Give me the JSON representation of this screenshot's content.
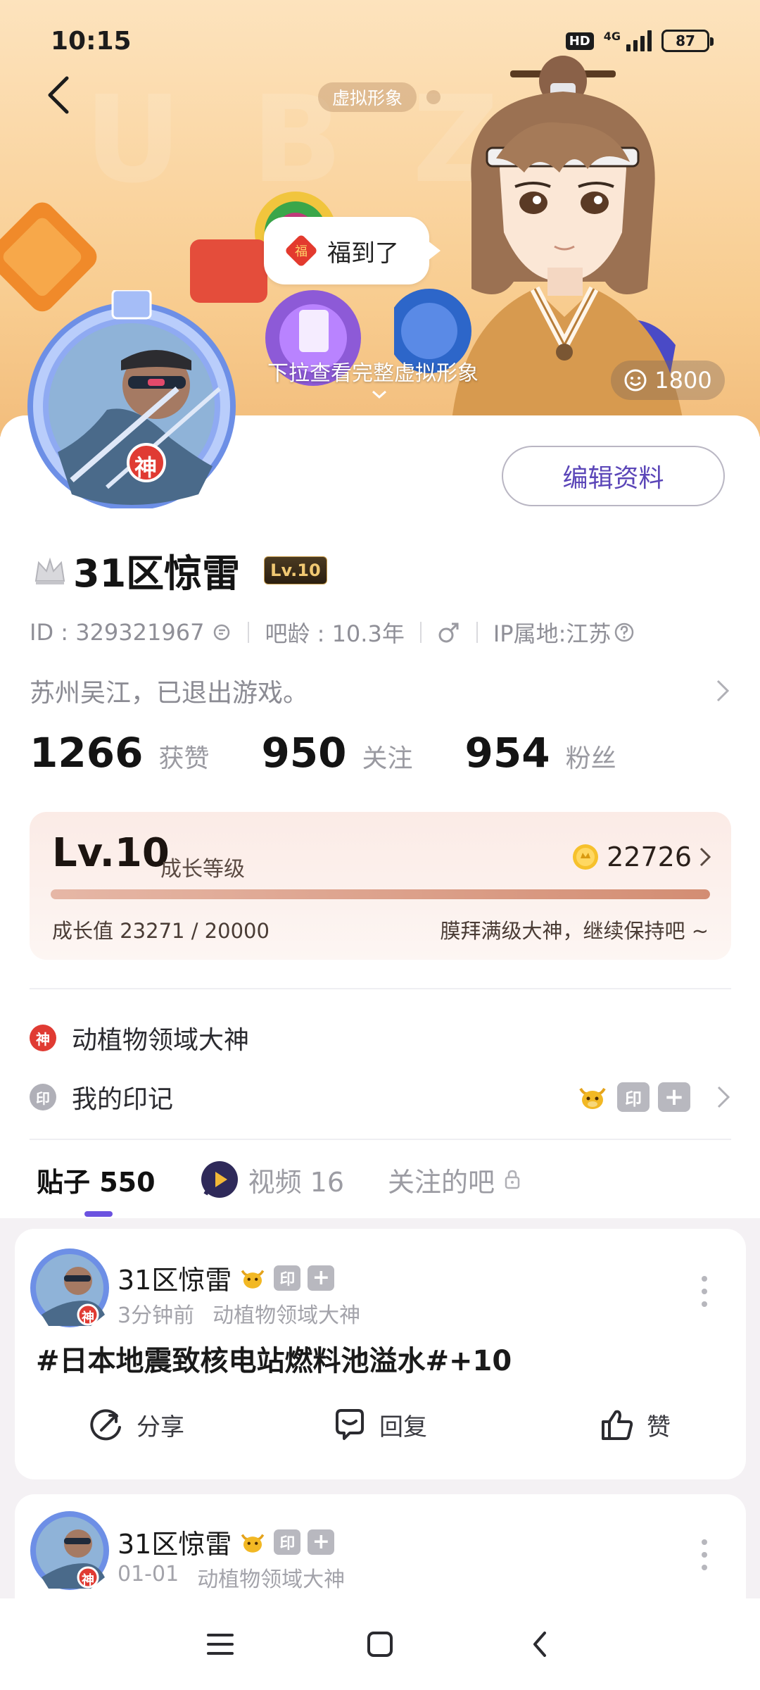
{
  "status_bar": {
    "time": "10:15",
    "hd": "HD",
    "network": "4G",
    "battery": "87"
  },
  "banner": {
    "avatar_pill": "虚拟形象",
    "bubble_text": "福到了",
    "bubble_icon_char": "福",
    "pull_hint": "下拉查看完整虚拟形象",
    "likes": "1800",
    "watermark": "U  B  Z"
  },
  "profile": {
    "avatar_badge": "神",
    "edit_button": "编辑资料",
    "name": "31区惊雷",
    "level_badge": "Lv.10",
    "id": "ID : 329321967",
    "bar_age": "吧龄 : 10.3年",
    "ip": "IP属地:江苏",
    "bio": "苏州吴江，已退出游戏。"
  },
  "stats": [
    {
      "num": "1266",
      "label": "获赞"
    },
    {
      "num": "950",
      "label": "关注"
    },
    {
      "num": "954",
      "label": "粉丝"
    }
  ],
  "growth": {
    "level": "Lv.10",
    "label": "成长等级",
    "coins": "22726",
    "value_text": "成长值 23271 / 20000",
    "tip": "膜拜满级大神，继续保持吧 ~",
    "progress": 1.0
  },
  "honors": {
    "god_icon": "神",
    "god_label": "动植物领域大神",
    "stamp_icon": "印",
    "stamp_label": "我的印记",
    "stamp_badge": "印",
    "stamp_plus": "+"
  },
  "tabs": {
    "posts": "贴子 550",
    "videos": "视频 16",
    "followed_bars": "关注的吧"
  },
  "posts": [
    {
      "author": "31区惊雷",
      "badge": "神",
      "stamp": "印",
      "plus": "+",
      "time": "3分钟前",
      "tag": "动植物领域大神",
      "title": "#日本地震致核电站燃料池溢水#+10",
      "share": "分享",
      "reply": "回复",
      "like": "赞"
    },
    {
      "author": "31区惊雷",
      "badge": "神",
      "stamp": "印",
      "plus": "+",
      "time": "01-01",
      "tag": "动植物领域大神"
    }
  ],
  "colors": {
    "accent": "#6b52e0",
    "edit_text": "#5b46b8",
    "god_red": "#e03b33",
    "banner_top": "#fde3bd",
    "banner_bottom": "#f2bd7c"
  }
}
